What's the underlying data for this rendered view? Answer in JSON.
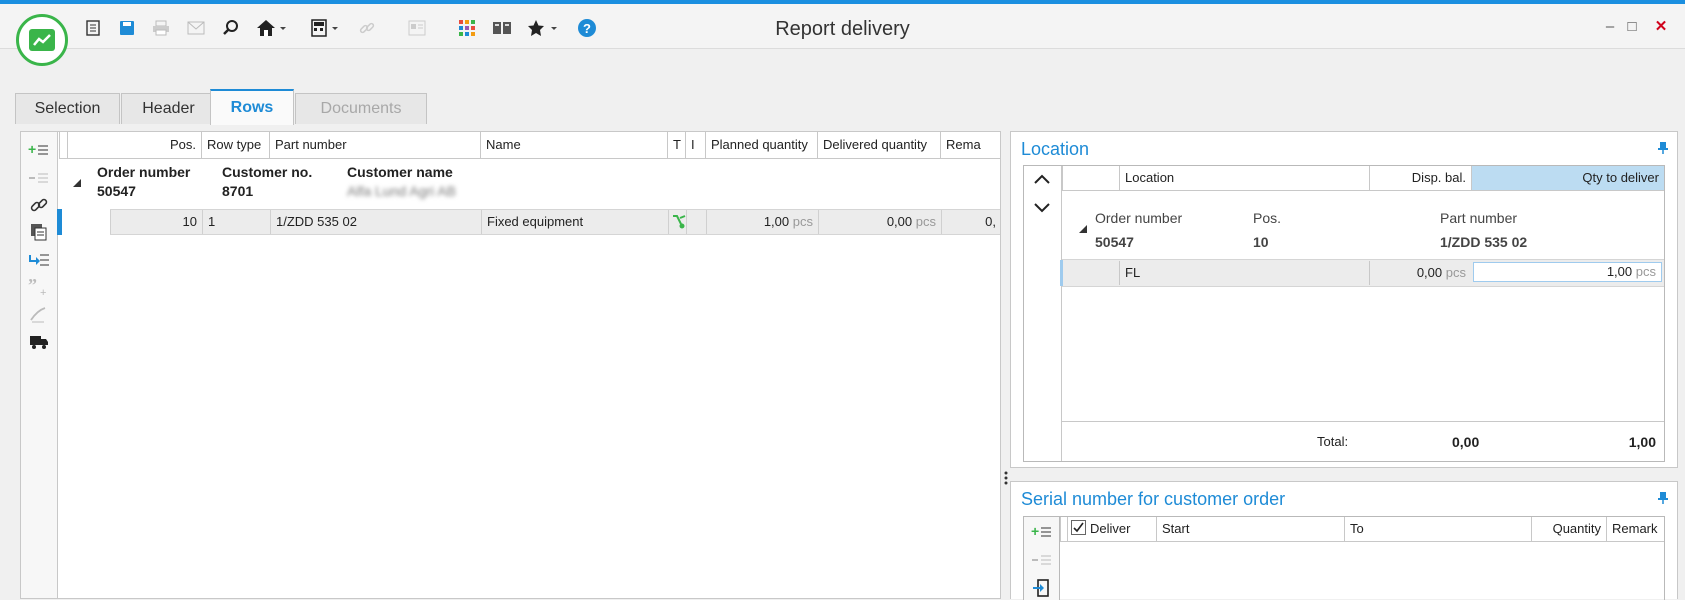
{
  "window": {
    "title": "Report delivery",
    "minimize": "–",
    "maximize": "□",
    "close": "✕"
  },
  "colors": {
    "accent": "#1e8bd6",
    "brand_green": "#3ab54a",
    "close_red": "#d0021b"
  },
  "toolbar": {
    "icons": [
      "list-icon",
      "save-icon",
      "print-icon",
      "mail-icon",
      "search-icon",
      "home-icon",
      "calculator-icon",
      "link-icon",
      "card-icon",
      "apps-grid-icon",
      "book-icon",
      "star-icon",
      "help-icon"
    ]
  },
  "tabs": [
    {
      "label": "Selection",
      "state": "normal"
    },
    {
      "label": "Header",
      "state": "normal"
    },
    {
      "label": "Rows",
      "state": "active"
    },
    {
      "label": "Documents",
      "state": "disabled"
    }
  ],
  "rows_grid": {
    "columns": [
      "Pos.",
      "Row type",
      "Part number",
      "Name",
      "T",
      "I",
      "Planned quantity",
      "Delivered quantity",
      "Rema"
    ],
    "group": {
      "order_number_label": "Order number",
      "order_number": "50547",
      "customer_no_label": "Customer no.",
      "customer_no": "8701",
      "customer_name_label": "Customer name",
      "customer_name": "Alfa Lund Agri AB"
    },
    "rows": [
      {
        "pos": "10",
        "row_type": "1",
        "part_number": "1/ZDD 535 02",
        "name": "Fixed equipment",
        "planned_qty": "1,00",
        "planned_unit": "pcs",
        "delivered_qty": "0,00",
        "delivered_unit": "pcs",
        "remaining": "0,"
      }
    ]
  },
  "location_panel": {
    "title": "Location",
    "columns": [
      "Location",
      "Disp. bal.",
      "Qty to deliver"
    ],
    "group": {
      "order_number_label": "Order number",
      "order_number": "50547",
      "pos_label": "Pos.",
      "pos": "10",
      "part_number_label": "Part number",
      "part_number": "1/ZDD 535 02"
    },
    "rows": [
      {
        "location": "FL",
        "disp_bal": "0,00",
        "disp_unit": "pcs",
        "qty_to_deliver": "1,00",
        "qty_unit": "pcs"
      }
    ],
    "total_label": "Total:",
    "total_disp": "0,00",
    "total_qty": "1,00"
  },
  "serial_panel": {
    "title": "Serial number for customer order",
    "columns": [
      "Deliver",
      "Start",
      "To",
      "Quantity",
      "Remark"
    ]
  }
}
